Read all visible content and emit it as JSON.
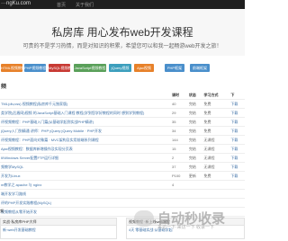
{
  "header": {
    "logo": "···ngKu.com",
    "nav": [
      "首页",
      "关于我们"
    ]
  },
  "hero": {
    "title": "私房库 用心发布web开发课程",
    "subtitle": "可贵的不是学习热情，而是对知识的积累，希望您可以和我一起畅游web开发之旅！"
  },
  "tags": [
    {
      "label": "HTML视频教程",
      "color": "#e7812a"
    },
    {
      "label": "PHP视频教程",
      "color": "#4a8fcb"
    },
    {
      "label": "MySQL视频教程",
      "color": "#c83a34"
    },
    {
      "label": "JavaScript视频教程",
      "color": "#5aa05a"
    },
    {
      "label": "jQuery视频",
      "color": "#3d9fbd"
    },
    {
      "label": "Ajax视频",
      "color": "#e7812a"
    },
    {
      "label": "PHP框架",
      "color": "#4a8fcb"
    },
    {
      "label": "前端框架",
      "color": "#4a8fcb"
    }
  ],
  "section": {
    "title": "频"
  },
  "table": {
    "headers": [
      "",
      "课时",
      "状态",
      "学习方式",
      "下"
    ],
    "rows": [
      [
        "TML(div,css) 视频教程(私房库千元独家版)",
        "40",
        "完结",
        "免费",
        "下载"
      ],
      [
        "类学院(后盾网)视频 的JavaScript基础入门课程 教程(学到您学好教程的同时 想到学到教程)",
        "29",
        "完结",
        "免费",
        "下载"
      ],
      [
        "评视频教程：PHP基础入门篇(从基础学起到实战PHP精讲)",
        "35",
        "完结",
        "免费",
        "下载"
      ],
      [
        "jQuery入门到精通 讲师：PHP·jQuery·jQuery Mobile · PHP开发",
        "34",
        "完结",
        "免费",
        "下载"
      ],
      [
        "评视频教程：PHP面向对象篇 · MVC架构及实用前端系列课程",
        "144",
        "完结",
        "无课程",
        "下载"
      ],
      [
        "Ajax视频教程：数据库新增操作及实现分页表",
        "15",
        "完结",
        "无课程",
        "下载"
      ],
      [
        "IIIWindows Server配置FTP运行详细",
        "2",
        "完结",
        "无课程",
        "下载"
      ],
      [
        "频教学MySQL",
        "37",
        "完结",
        "无课程",
        "下载"
      ],
      [
        "开发为Linux",
        "P100",
        "更新",
        "免费",
        "下载"
      ],
      [
        "m教学之 apache 与 nginx",
        "4",
        "",
        "",
        ""
      ],
      [
        "端开发学习路线",
        "",
        "",
        "",
        ""
      ],
      [
        "评的PHP开发实践教程(MySQL)",
        "",
        "",
        "",
        ""
      ],
      [
        "视频教程从零开始开发",
        "",
        "",
        "",
        ""
      ]
    ]
  },
  "bottom": {
    "section_title": "频",
    "panels": [
      {
        "title": "实战·私房库PHP大师",
        "row": "新·web开发基础教程"
      },
      {
        "title": "视频教程 ·新上线web课程",
        "row": "4天 零基础实战·从基础学起"
      }
    ]
  },
  "watermark": {
    "title": "自动秒收录",
    "subtitle": "来访一下·来访一下 收录一下"
  }
}
